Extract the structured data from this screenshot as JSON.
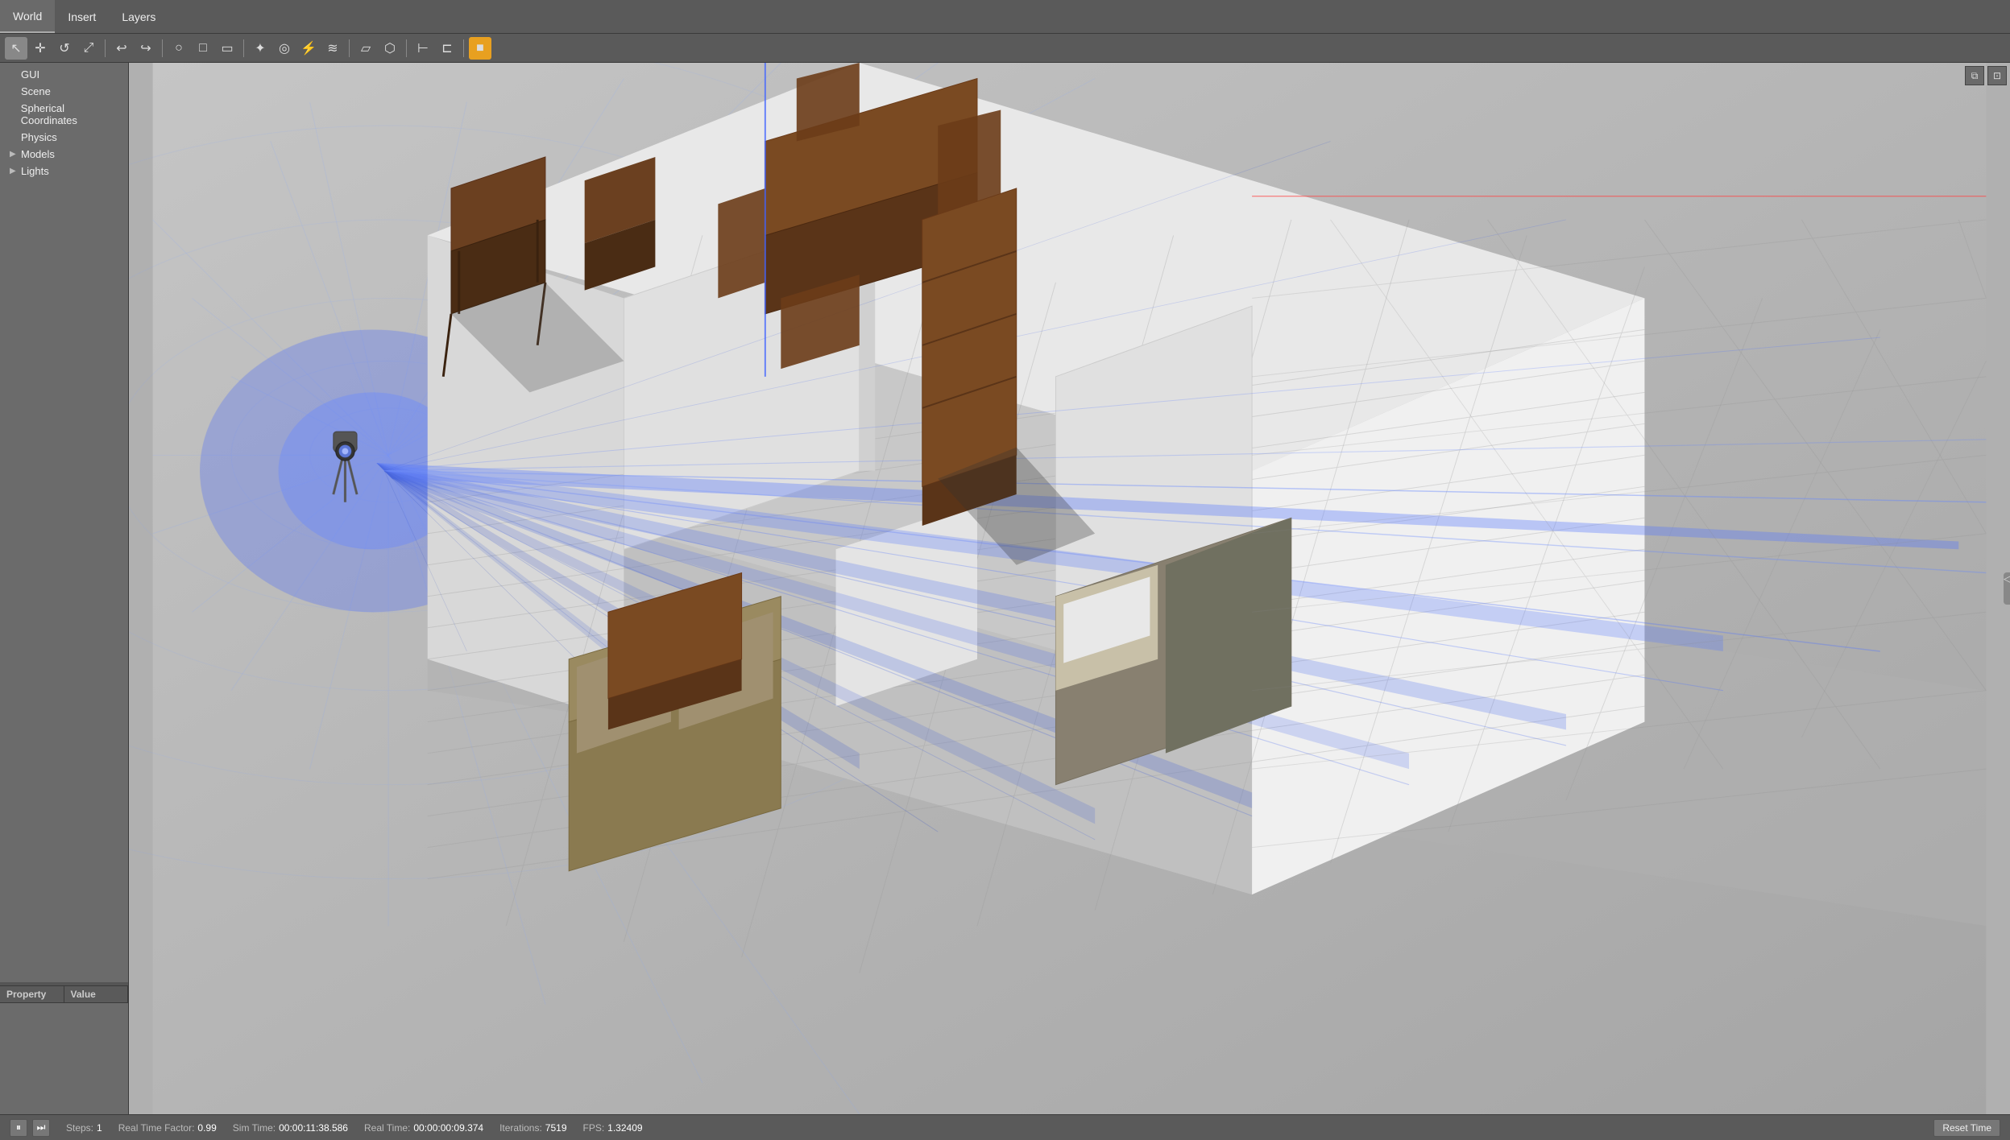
{
  "menuBar": {
    "items": [
      {
        "id": "world",
        "label": "World",
        "active": true
      },
      {
        "id": "insert",
        "label": "Insert",
        "active": false
      },
      {
        "id": "layers",
        "label": "Layers",
        "active": false
      }
    ]
  },
  "toolbar": {
    "tools": [
      {
        "id": "select",
        "icon": "↖",
        "title": "Select"
      },
      {
        "id": "translate",
        "icon": "✛",
        "title": "Translate"
      },
      {
        "id": "rotate",
        "icon": "↺",
        "title": "Rotate"
      },
      {
        "id": "scale",
        "icon": "⤢",
        "title": "Scale"
      },
      {
        "id": "sep1",
        "type": "separator"
      },
      {
        "id": "undo",
        "icon": "↩",
        "title": "Undo"
      },
      {
        "id": "redo",
        "icon": "↪",
        "title": "Redo"
      },
      {
        "id": "sep2",
        "type": "separator"
      },
      {
        "id": "circle",
        "icon": "○",
        "title": "Circle"
      },
      {
        "id": "square",
        "icon": "□",
        "title": "Square"
      },
      {
        "id": "box",
        "icon": "▭",
        "title": "Box"
      },
      {
        "id": "sep3",
        "type": "separator"
      },
      {
        "id": "light",
        "icon": "☀",
        "title": "Light"
      },
      {
        "id": "camera",
        "icon": "◎",
        "title": "Camera"
      },
      {
        "id": "plugin",
        "icon": "⚡",
        "title": "Plugin"
      },
      {
        "id": "wave",
        "icon": "≋",
        "title": "Wave"
      },
      {
        "id": "sep4",
        "type": "separator"
      },
      {
        "id": "shape1",
        "icon": "▱",
        "title": "Shape1"
      },
      {
        "id": "shape2",
        "icon": "⬡",
        "title": "Shape2"
      },
      {
        "id": "sep5",
        "type": "separator"
      },
      {
        "id": "align",
        "icon": "⊢",
        "title": "Align"
      },
      {
        "id": "snap",
        "icon": "⊏",
        "title": "Snap"
      },
      {
        "id": "sep6",
        "type": "separator"
      },
      {
        "id": "orange",
        "icon": "■",
        "title": "Active",
        "active": true
      }
    ]
  },
  "sidebar": {
    "treeItems": [
      {
        "id": "gui",
        "label": "GUI",
        "indent": 0,
        "hasArrow": false
      },
      {
        "id": "scene",
        "label": "Scene",
        "indent": 0,
        "hasArrow": false
      },
      {
        "id": "spherical",
        "label": "Spherical Coordinates",
        "indent": 0,
        "hasArrow": false
      },
      {
        "id": "physics",
        "label": "Physics",
        "indent": 0,
        "hasArrow": false
      },
      {
        "id": "models",
        "label": "Models",
        "indent": 0,
        "hasArrow": true,
        "expanded": false
      },
      {
        "id": "lights",
        "label": "Lights",
        "indent": 0,
        "hasArrow": true,
        "expanded": false
      }
    ],
    "properties": {
      "columns": [
        {
          "id": "property",
          "label": "Property"
        },
        {
          "id": "value",
          "label": "Value"
        }
      ]
    }
  },
  "statusBar": {
    "pauseIcon": "⏸",
    "stepForwardIcon": "⏭",
    "stepsLabel": "Steps:",
    "stepsValue": "1",
    "realTimeFactorLabel": "Real Time Factor:",
    "realTimeFactorValue": "0.99",
    "simTimeLabel": "Sim Time:",
    "simTimeValue": "00:00:11:38.586",
    "realTimeLabel": "Real Time:",
    "realTimeValue": "00:00:00:09.374",
    "iterationsLabel": "Iterations:",
    "iterationsValue": "7519",
    "fpsLabel": "FPS:",
    "fpsValue": "1.32409",
    "resetTimeLabel": "Reset Time"
  },
  "viewport": {
    "windowBtn1": "⧉",
    "windowBtn2": "⊡",
    "rightResizeIcon": "◁"
  }
}
